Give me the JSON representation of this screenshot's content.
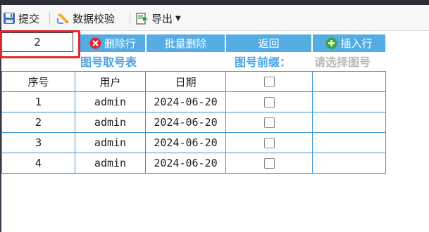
{
  "toolbar": {
    "submit_label": "提交",
    "validate_label": "数据校验",
    "export_label": "导出"
  },
  "actions": {
    "row_input_value": "2",
    "delete_row_label": "删除行",
    "batch_delete_label": "批量删除",
    "back_label": "返回",
    "insert_row_label": "插入行"
  },
  "form": {
    "table_title": "图号取号表",
    "prefix_label": "图号前缀：",
    "prefix_placeholder": "请选择图号"
  },
  "table": {
    "headers": [
      "序号",
      "用户",
      "日期",
      "",
      ""
    ],
    "rows": [
      {
        "no": "1",
        "user": "admin",
        "date": "2024-06-20",
        "checked": false
      },
      {
        "no": "2",
        "user": "admin",
        "date": "2024-06-20",
        "checked": false
      },
      {
        "no": "3",
        "user": "admin",
        "date": "2024-06-20",
        "checked": false
      },
      {
        "no": "4",
        "user": "admin",
        "date": "2024-06-20",
        "checked": false
      }
    ]
  },
  "colors": {
    "accent": "#55ace3",
    "title_blue": "#4aa4e6",
    "grid_border": "#3d94d6",
    "highlight_red": "#e3262b",
    "placeholder_gray": "#b9b9b9"
  },
  "icons": {
    "submit": "floppy-disk-icon",
    "validate": "pencil-ruler-icon",
    "export": "export-icon",
    "export_caret": "caret-down-icon",
    "delete_row": "red-x-circle-icon",
    "insert_row": "green-plus-circle-icon"
  }
}
